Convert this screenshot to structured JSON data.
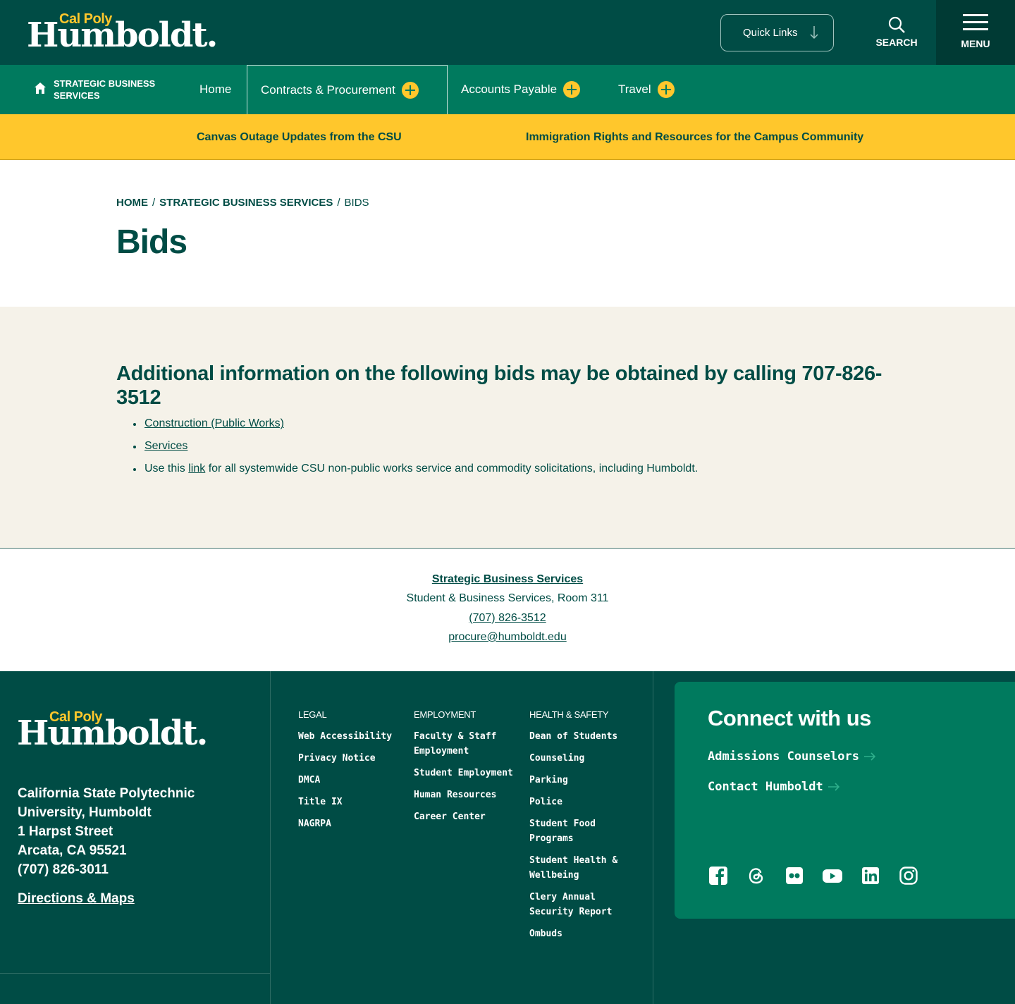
{
  "header": {
    "logo_top": "Cal Poly",
    "logo_main": "Humboldt.",
    "quick_links_label": "Quick Links",
    "search_label": "SEARCH",
    "menu_label": "MENU"
  },
  "section_nav": {
    "site_title": "STRATEGIC BUSINESS SERVICES",
    "items": [
      {
        "label": "Home"
      },
      {
        "label": "Contracts & Procurement"
      },
      {
        "label": "Accounts Payable"
      },
      {
        "label": "Travel"
      }
    ]
  },
  "alerts": {
    "alert1_link": "Canvas Outage Updates from the CSU",
    "alert2_link": "Immigration Rights and Resources",
    "alert2_text": " for the Campus Community"
  },
  "breadcrumb": {
    "home": "HOME",
    "section": "STRATEGIC BUSINESS SERVICES",
    "current": "BIDS"
  },
  "page_title": "Bids",
  "content": {
    "heading": "Additional information on the following bids may be obtained by calling 707-826-3512",
    "item1": "Construction (Public Works)",
    "item2": "Services",
    "item3_pre": "Use this ",
    "item3_link": "link",
    "item3_post": " for all systemwide CSU non-public works service and commodity solicitations, including Humboldt."
  },
  "contact": {
    "name": "Strategic Business Services",
    "location": "Student & Business Services, Room 311",
    "phone": "(707) 826-3512",
    "email": "procure@humboldt.edu"
  },
  "footer": {
    "logo_top": "Cal Poly",
    "logo_main": "Humboldt.",
    "address": {
      "line1": "California State Polytechnic",
      "line2": "University, Humboldt",
      "line3": "1 Harpst Street",
      "line4": "Arcata, CA 95521",
      "line5": "(707) 826-3011"
    },
    "directions": "Directions & Maps",
    "legal": {
      "heading": "LEGAL",
      "items": [
        "Web Accessibility",
        "Privacy Notice",
        "DMCA",
        "Title IX",
        "NAGRPA"
      ]
    },
    "employment": {
      "heading": "EMPLOYMENT",
      "items": [
        "Faculty & Staff Employment",
        "Student Employment",
        "Human Resources",
        "Career Center"
      ]
    },
    "health": {
      "heading": "HEALTH & SAFETY",
      "items": [
        "Dean of Students",
        "Counseling",
        "Parking",
        "Police",
        "Student Food Programs",
        "Student Health & Wellbeing",
        "Clery Annual Security Report",
        "Ombuds"
      ]
    },
    "connect": {
      "title": "Connect with us",
      "link1": "Admissions Counselors",
      "link2": "Contact Humboldt",
      "social": [
        "facebook-icon",
        "threads-icon",
        "flickr-icon",
        "youtube-icon",
        "linkedin-icon",
        "instagram-icon"
      ]
    }
  },
  "colors": {
    "dark_green": "#004c45",
    "green": "#007a5e",
    "gold": "#ffc72c",
    "cream": "#f5f2e9"
  }
}
